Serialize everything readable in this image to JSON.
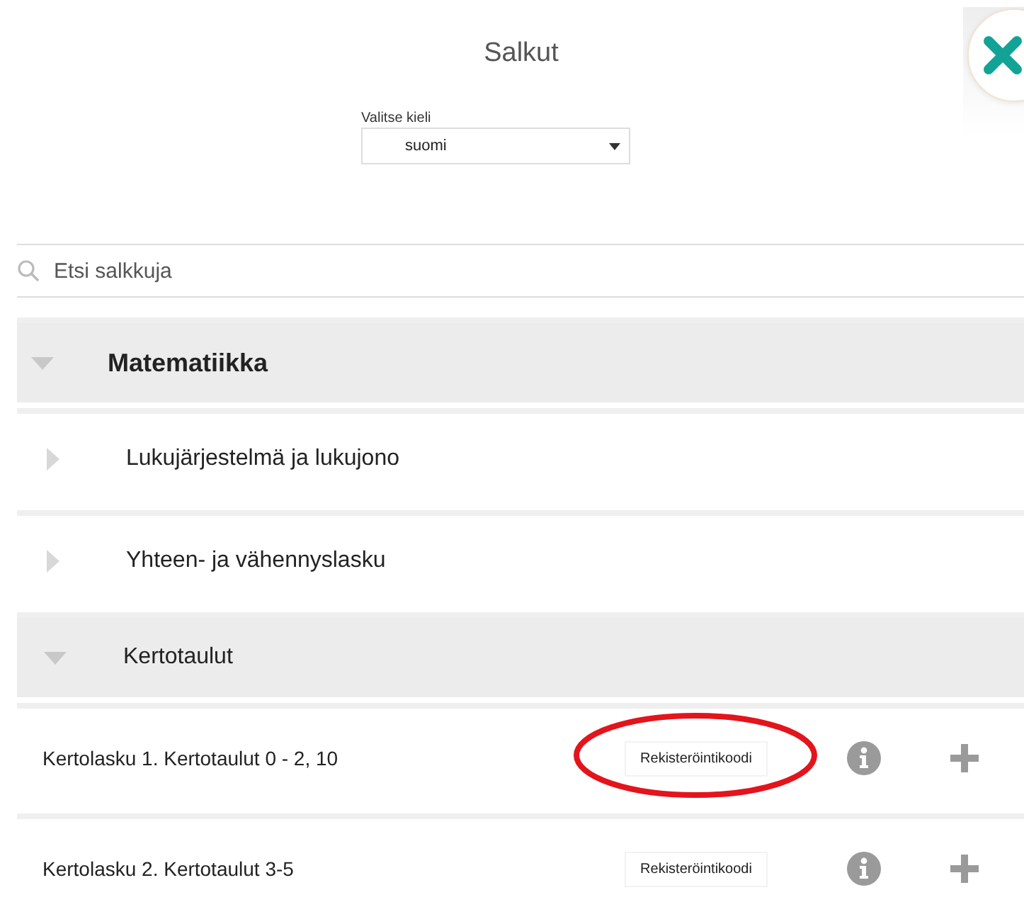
{
  "title": "Salkut",
  "language": {
    "label": "Valitse kieli",
    "value": "suomi"
  },
  "search": {
    "placeholder": "Etsi salkkuja"
  },
  "tree": [
    {
      "kind": "group",
      "label": "Matematiikka",
      "expanded": true,
      "children": [
        {
          "kind": "group",
          "label": "Lukujärjestelmä ja lukujono",
          "expanded": false
        },
        {
          "kind": "group",
          "label": "Yhteen- ja vähennyslasku",
          "expanded": false
        },
        {
          "kind": "group",
          "label": "Kertotaulut",
          "expanded": true,
          "children": [
            {
              "kind": "entry",
              "label": "Kertolasku 1. Kertotaulut 0 - 2, 10",
              "code_button": "Rekisteröintikoodi",
              "highlighted": true
            },
            {
              "kind": "entry",
              "label": "Kertolasku 2. Kertotaulut 3-5",
              "code_button": "Rekisteröintikoodi",
              "highlighted": false
            }
          ]
        }
      ]
    }
  ]
}
